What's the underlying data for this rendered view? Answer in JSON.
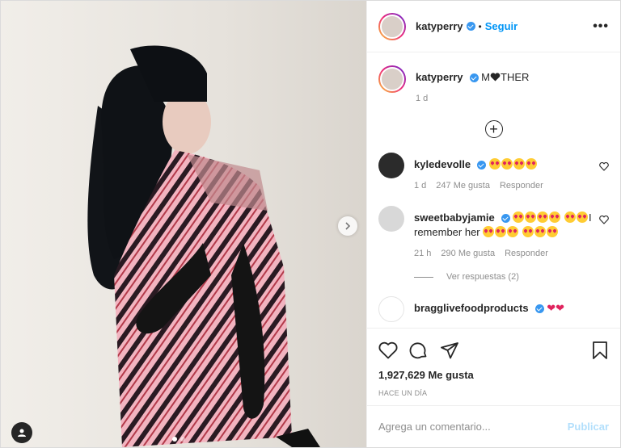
{
  "post": {
    "username": "katyperry",
    "follow_label": "Seguir",
    "separator": "•",
    "more_label": "•••"
  },
  "caption": {
    "username": "katyperry",
    "text_before": "M",
    "text_after": "THER",
    "time": "1 d"
  },
  "comments": [
    {
      "username": "kyledevolle",
      "text": "",
      "time": "1 d",
      "likes": "247 Me gusta",
      "reply": "Responder"
    },
    {
      "username": "sweetbabyjamie",
      "text": "I remember her",
      "time": "21 h",
      "likes": "290 Me gusta",
      "reply": "Responder"
    },
    {
      "username": "bragglivefoodproducts",
      "text": ""
    }
  ],
  "replies_label": "Ver respuestas (2)",
  "likes": "1,927,629 Me gusta",
  "posted": "HACE UN DÍA",
  "comment_input": {
    "placeholder": "Agrega un comentario...",
    "value": ""
  },
  "publish_label": "Publicar",
  "colors": {
    "accent": "#0095f6",
    "verified": "#3897f0",
    "publish_disabled": "#b2dffc"
  },
  "icons": [
    "heart-icon",
    "comment-icon",
    "share-icon",
    "bookmark-icon",
    "plus-circle-icon",
    "next-arrow-icon",
    "user-tag-icon",
    "more-icon",
    "verified-icon"
  ]
}
